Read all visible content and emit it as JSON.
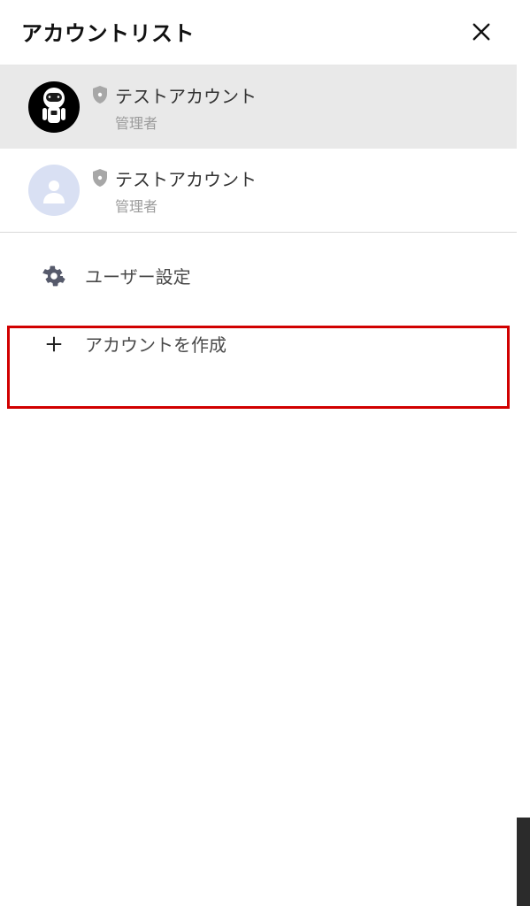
{
  "header": {
    "title": "アカウントリスト"
  },
  "accounts": [
    {
      "name": "テストアカウント",
      "role": "管理者"
    },
    {
      "name": "テストアカウント",
      "role": "管理者"
    }
  ],
  "options": {
    "user_settings": "ユーザー設定",
    "create_account": "アカウントを作成"
  }
}
